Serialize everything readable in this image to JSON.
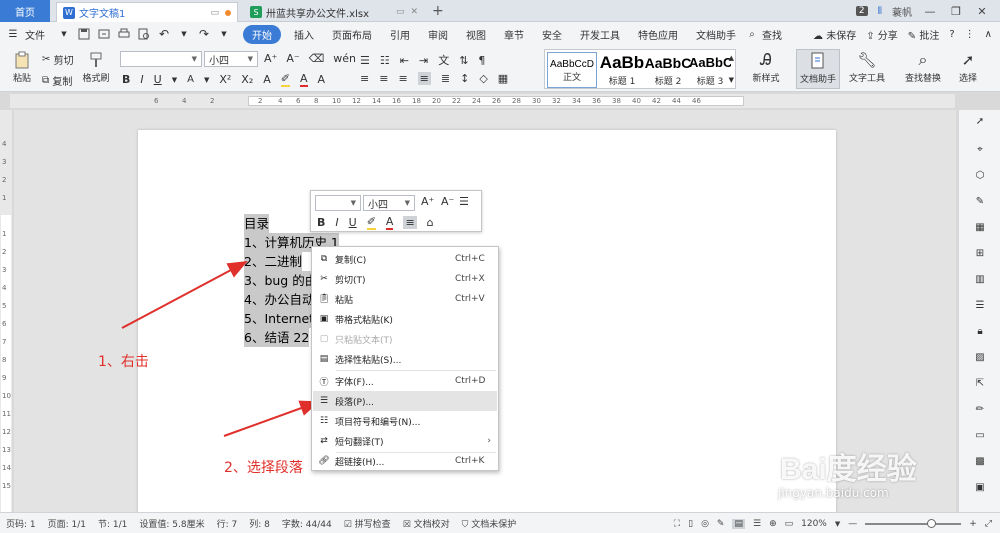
{
  "tabs": {
    "home": "首页",
    "doc": "文字文稿1",
    "xls": "卅蓝共享办公文件.xlsx",
    "doc_badge": "W",
    "xls_badge": "S"
  },
  "titlebar_right": {
    "count": "2",
    "user": "蓑帆"
  },
  "menu": {
    "file": "文件",
    "items": [
      "开始",
      "插入",
      "页面布局",
      "引用",
      "审阅",
      "视图",
      "章节",
      "安全",
      "开发工具",
      "特色应用",
      "文档助手"
    ],
    "search": "查找",
    "right": [
      "未保存",
      "分享",
      "批注"
    ]
  },
  "ribbon": {
    "paste": "粘贴",
    "cut": "剪切",
    "copy": "复制",
    "format_painter": "格式刷",
    "font_size": "小四",
    "styles": [
      {
        "sample": "AaBbCcD",
        "label": "正文"
      },
      {
        "sample": "AaBb",
        "label": "标题 1"
      },
      {
        "sample": "AaBbC",
        "label": "标题 2"
      },
      {
        "sample": "AaBbC",
        "label": "标题 3"
      }
    ],
    "new_style": "新样式",
    "doc_assistant": "文档助手",
    "text_tools": "文字工具",
    "find_replace": "查找替换",
    "select": "选择"
  },
  "hruler_ticks": [
    "6",
    "4",
    "2",
    "2",
    "4",
    "6",
    "8",
    "10",
    "12",
    "14",
    "16",
    "18",
    "20",
    "22",
    "24",
    "26",
    "28",
    "30",
    "32",
    "34",
    "36",
    "38",
    "40",
    "42",
    "44",
    "46"
  ],
  "vruler_ticks": [
    "4",
    "3",
    "2",
    "1",
    "1",
    "2",
    "3",
    "4",
    "5",
    "6",
    "7",
    "8",
    "9",
    "10",
    "11",
    "12",
    "13",
    "14",
    "15"
  ],
  "document": {
    "lines": [
      "目录",
      "1、计算机历史 1",
      "2、二进制",
      "3、bug 的由",
      "4、办公自动",
      "5、Internet",
      "6、结语 22"
    ]
  },
  "annotations": {
    "step1": "1、右击",
    "step2": "2、选择段落"
  },
  "minibar": {
    "font_size": "小四"
  },
  "context_menu": [
    {
      "label": "复制(C)",
      "shortcut": "Ctrl+C",
      "icon": "copy-icon"
    },
    {
      "label": "剪切(T)",
      "shortcut": "Ctrl+X",
      "icon": "scissors-icon"
    },
    {
      "label": "粘贴",
      "shortcut": "Ctrl+V",
      "icon": "paste-icon"
    },
    {
      "label": "带格式粘贴(K)",
      "shortcut": "",
      "icon": "paste-format-icon"
    },
    {
      "label": "只粘贴文本(T)",
      "shortcut": "",
      "icon": "paste-text-icon",
      "disabled": true
    },
    {
      "label": "选择性粘贴(S)...",
      "shortcut": "",
      "icon": "paste-special-icon"
    },
    {
      "label": "字体(F)...",
      "shortcut": "Ctrl+D",
      "icon": "font-icon"
    },
    {
      "label": "段落(P)...",
      "shortcut": "",
      "icon": "paragraph-icon",
      "highlight": true
    },
    {
      "label": "项目符号和编号(N)...",
      "shortcut": "",
      "icon": "bullets-icon"
    },
    {
      "label": "短句翻译(T)",
      "shortcut": "",
      "icon": "translate-icon",
      "submenu": true
    },
    {
      "label": "超链接(H)...",
      "shortcut": "Ctrl+K",
      "icon": "link-icon"
    }
  ],
  "status": {
    "page_num": "页码: 1",
    "pages": "页面: 1/1",
    "section": "节: 1/1",
    "setting": "设置值: 5.8厘米",
    "row": "行: 7",
    "col": "列: 8",
    "words": "字数: 44/44",
    "spell": "拼写检查",
    "proof": "文档校对",
    "protect": "文档未保护",
    "zoom": "120%",
    "zoom_level": 0.69
  },
  "watermark": {
    "brand": "Bai度经验",
    "url": "jingyan.baidu.com"
  },
  "colors": {
    "accent": "#3a7bd5",
    "annotation": "#e0302b",
    "selection": "#c9c9c9",
    "menu_highlight": "#e4e4e4"
  }
}
